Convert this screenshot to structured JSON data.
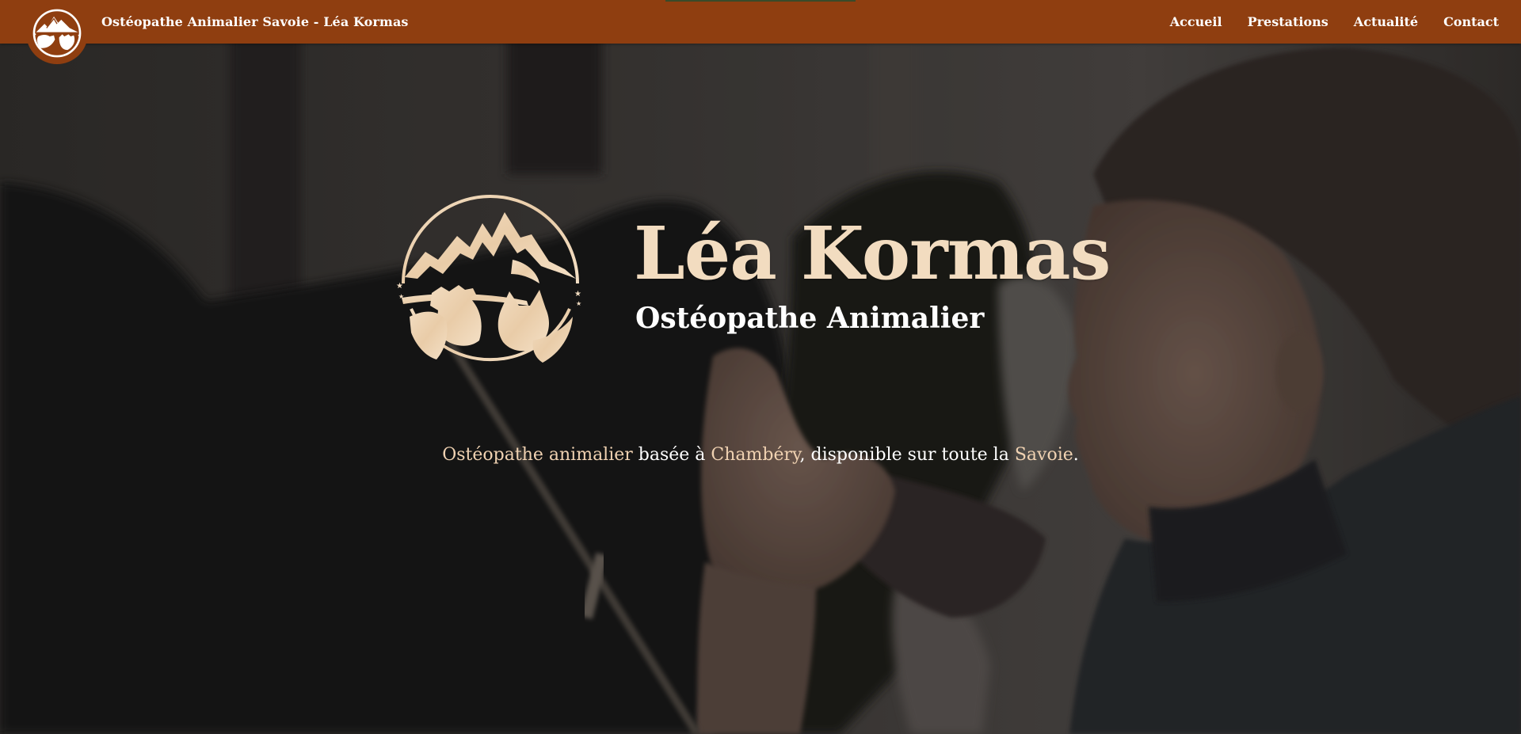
{
  "colors": {
    "navbar_bg": "#8f3e10",
    "accent_cream": "#f2dcc0",
    "text_white": "#ffffff"
  },
  "navbar": {
    "site_title": "Ostéopathe Animalier Savoie - Léa Kormas",
    "logo_icon": "mountain-animals-emblem-icon",
    "menu": [
      {
        "label": "Accueil"
      },
      {
        "label": "Prestations"
      },
      {
        "label": "Actualité"
      },
      {
        "label": "Contact"
      }
    ]
  },
  "hero": {
    "emblem_icon": "mountain-cow-cat-emblem-icon",
    "name": "Léa Kormas",
    "subtitle": "Ostéopathe Animalier",
    "tagline": {
      "part1_highlight": "Ostéopathe animalier",
      "part2": " basée à ",
      "part3_highlight": "Chambéry",
      "part4": ", disponible sur toute la ",
      "part5_highlight": "Savoie",
      "part6": "."
    }
  }
}
